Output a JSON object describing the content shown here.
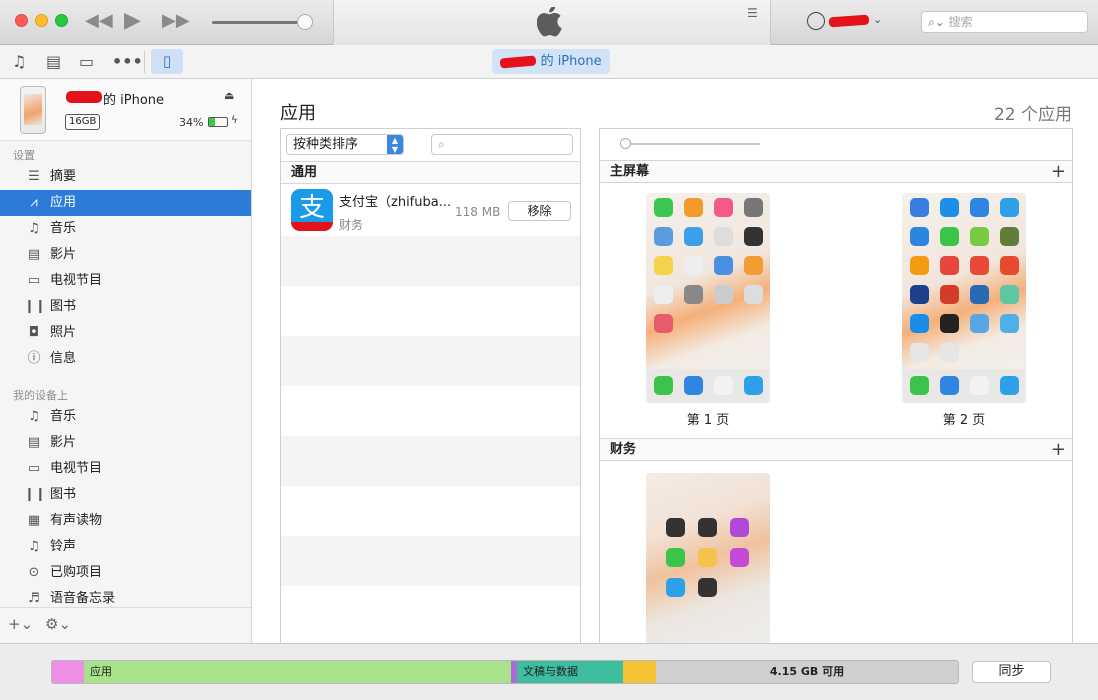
{
  "search": {
    "placeholder": "搜索"
  },
  "toolbar": {
    "device_pill": "的 iPhone"
  },
  "device": {
    "name": "的 iPhone",
    "capacity": "16GB",
    "battery": "34%"
  },
  "sidebar": {
    "settings_header": "设置",
    "settings_items": [
      {
        "label": "摘要",
        "icon": "summary-icon"
      },
      {
        "label": "应用",
        "icon": "apps-icon"
      },
      {
        "label": "音乐",
        "icon": "music-icon"
      },
      {
        "label": "影片",
        "icon": "film-icon"
      },
      {
        "label": "电视节目",
        "icon": "tv-icon"
      },
      {
        "label": "图书",
        "icon": "book-icon"
      },
      {
        "label": "照片",
        "icon": "camera-icon"
      },
      {
        "label": "信息",
        "icon": "info-icon"
      }
    ],
    "device_header": "我的设备上",
    "device_items": [
      {
        "label": "音乐",
        "icon": "music-icon"
      },
      {
        "label": "影片",
        "icon": "film-icon"
      },
      {
        "label": "电视节目",
        "icon": "tv-icon"
      },
      {
        "label": "图书",
        "icon": "book-icon"
      },
      {
        "label": "有声读物",
        "icon": "audiobook-icon"
      },
      {
        "label": "铃声",
        "icon": "bell-icon"
      },
      {
        "label": "已购项目",
        "icon": "purchased-icon"
      },
      {
        "label": "语音备忘录",
        "icon": "voice-memo-icon"
      }
    ]
  },
  "main": {
    "title": "应用",
    "count": "22 个应用",
    "sort_label": "按种类排序",
    "group_label": "通用",
    "app": {
      "name": "支付宝（zhifuba...",
      "category": "财务",
      "size": "118 MB",
      "remove_label": "移除"
    },
    "home_header": "主屏幕",
    "finance_header": "财务",
    "page1_label": "第 1 页",
    "page2_label": "第 2 页"
  },
  "storage": {
    "apps_label": "应用",
    "docs_label": "文稿与数据",
    "free_label": "4.15 GB 可用",
    "sync_label": "同步",
    "colors": {
      "pink": "#ee8fe6",
      "apps": "#a6e38b",
      "purple": "#b06ad6",
      "docs": "#3fbd9f",
      "yellow": "#f5c332",
      "free": "#cfcfcf"
    }
  }
}
